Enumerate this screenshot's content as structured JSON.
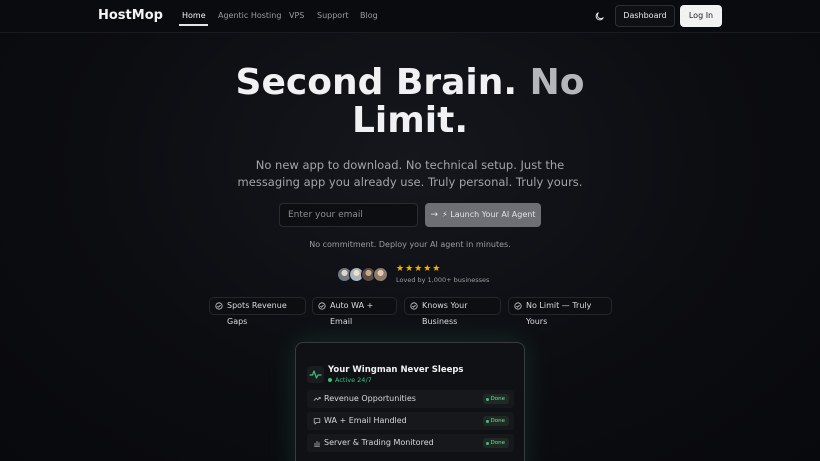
{
  "nav": {
    "logo": "HostMop",
    "links": [
      "Home",
      "Agentic Hosting",
      "VPS",
      "Support",
      "Blog"
    ],
    "active_link": "Home",
    "theme_icon": "moon-icon",
    "dashboard_label": "Dashboard",
    "login_label": "Log In"
  },
  "hero": {
    "title_main": "Second Brain.",
    "title_muted": "No",
    "title_line2": "Limit.",
    "subtitle_line1": "No new app to download. No technical setup. Just the",
    "subtitle_line2": "messaging app you already use. Truly personal. Truly yours.",
    "email_placeholder": "Enter your email",
    "launch_label": "⚡ Launch Your AI Agent",
    "note": "No commitment. Deploy your AI agent in minutes."
  },
  "social": {
    "stars": "★★★★★",
    "rating": 5,
    "loved_text": "Loved by 1,000+ businesses"
  },
  "chips": [
    "Spots Revenue Gaps",
    "Auto WA + Email",
    "Knows Your Business",
    "No Limit — Truly Yours"
  ],
  "card": {
    "title": "Your Wingman Never Sleeps",
    "status": "Active 24/7",
    "rows": [
      {
        "label": "Revenue Opportunities",
        "badge": "Done",
        "icon": "trend-up-icon"
      },
      {
        "label": "WA + Email Handled",
        "badge": "Done",
        "icon": "chat-icon"
      },
      {
        "label": "Server & Trading Monitored",
        "badge": "Done",
        "icon": "bar-chart-icon"
      }
    ]
  },
  "colors": {
    "background": "#0c0d11",
    "accent_green": "#39c27e",
    "star_yellow": "#f0b400",
    "launch_button": "#6e6f75"
  }
}
